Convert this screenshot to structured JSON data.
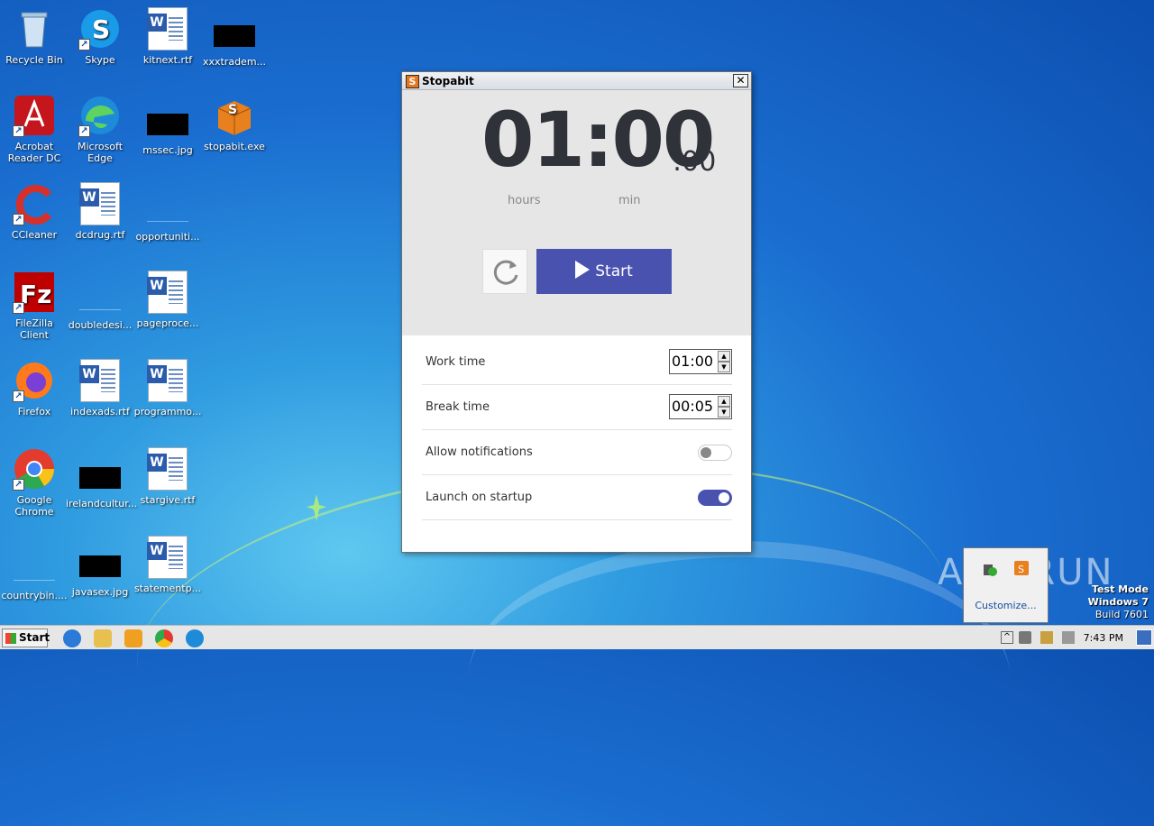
{
  "desktop": {
    "icons": [
      {
        "label": "Recycle Bin"
      },
      {
        "label": "Skype"
      },
      {
        "label": "kitnext.rtf"
      },
      {
        "label": "xxxtradem..."
      },
      {
        "label": "Acrobat Reader DC"
      },
      {
        "label": "Microsoft Edge"
      },
      {
        "label": "mssec.jpg"
      },
      {
        "label": "stopabit.exe"
      },
      {
        "label": "CCleaner"
      },
      {
        "label": "dcdrug.rtf"
      },
      {
        "label": "opportuniti..."
      },
      {
        "label": "FileZilla Client"
      },
      {
        "label": "doubledesi..."
      },
      {
        "label": "pageproce..."
      },
      {
        "label": "Firefox"
      },
      {
        "label": "indexads.rtf"
      },
      {
        "label": "programmo..."
      },
      {
        "label": "Google Chrome"
      },
      {
        "label": "irelandcultur..."
      },
      {
        "label": "stargive.rtf"
      },
      {
        "label": "countrybin...."
      },
      {
        "label": "javasex.jpg"
      },
      {
        "label": "statementp..."
      }
    ]
  },
  "app": {
    "title": "Stopabit",
    "logo_letter": "S",
    "close_glyph": "✕",
    "timer": {
      "main": "01:00",
      "seconds": ":00",
      "unit_hours": "hours",
      "unit_min": "min"
    },
    "start_label": "Start",
    "settings": {
      "work_time_label": "Work time",
      "work_time_value": "01:00",
      "break_time_label": "Break time",
      "break_time_value": "00:05",
      "notifications_label": "Allow notifications",
      "notifications_on": false,
      "startup_label": "Launch on startup",
      "startup_on": true
    }
  },
  "tray_popup": {
    "customize_label": "Customize..."
  },
  "watermark": "ANY RUN",
  "test_mode": {
    "line1": "Test Mode",
    "line2": "Windows 7",
    "line3": "Build 7601"
  },
  "taskbar": {
    "start_label": "Start",
    "clock": "7:43 PM"
  },
  "colors": {
    "accent": "#4a52b0",
    "desktop": "#1a6ed0"
  }
}
